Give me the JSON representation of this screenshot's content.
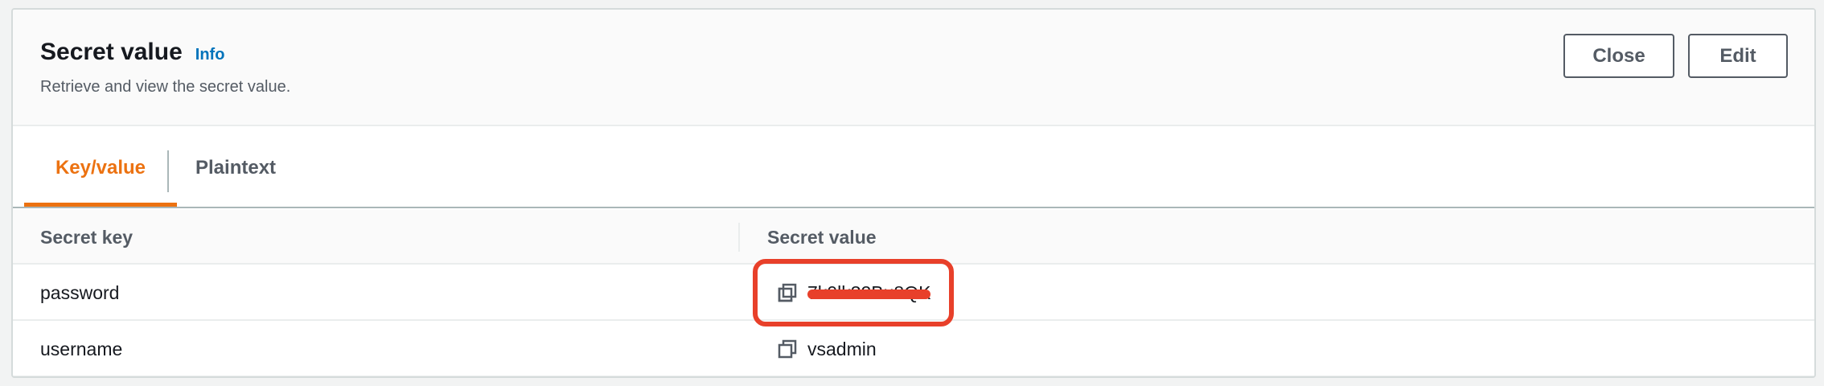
{
  "header": {
    "title": "Secret value",
    "info_link": "Info",
    "subtitle": "Retrieve and view the secret value.",
    "close_label": "Close",
    "edit_label": "Edit"
  },
  "tabs": [
    {
      "label": "Key/value",
      "active": true
    },
    {
      "label": "Plaintext",
      "active": false
    }
  ],
  "table": {
    "columns": [
      "Secret key",
      "Secret value"
    ],
    "rows": [
      {
        "key": "password",
        "value": "7k0lk32Bu8QK",
        "redacted": true
      },
      {
        "key": "username",
        "value": "vsadmin",
        "redacted": false
      }
    ]
  },
  "icons": {
    "copy": "copy-icon"
  },
  "colors": {
    "accent": "#ec7211",
    "link": "#0073bb",
    "annotation": "#e8402a",
    "text": "#16191f",
    "muted": "#545b64"
  }
}
